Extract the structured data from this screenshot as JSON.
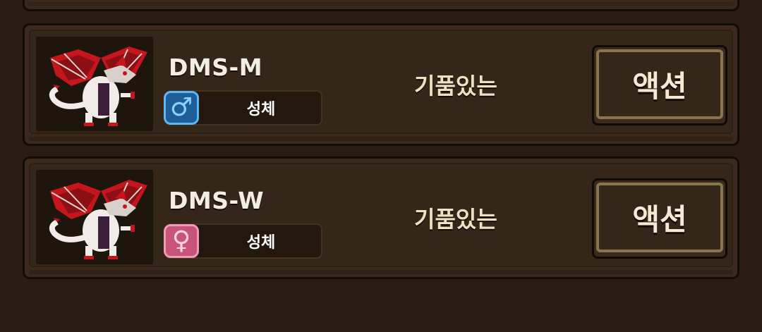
{
  "units": [
    {
      "name": "DMS-M",
      "gender": "male",
      "gender_symbol": "♂",
      "stage": "성체",
      "personality": "기품있는",
      "action_label": "액션",
      "portrait_icon": "red-white-dragon"
    },
    {
      "name": "DMS-W",
      "gender": "female",
      "gender_symbol": "♀",
      "stage": "성체",
      "personality": "기품있는",
      "action_label": "액션",
      "portrait_icon": "red-white-dragon"
    }
  ],
  "colors": {
    "background": "#2a1d13",
    "card": "#3b2a1b",
    "male_badge": "#1f5d98",
    "female_badge": "#c8547a",
    "button_border": "#8a7450"
  }
}
